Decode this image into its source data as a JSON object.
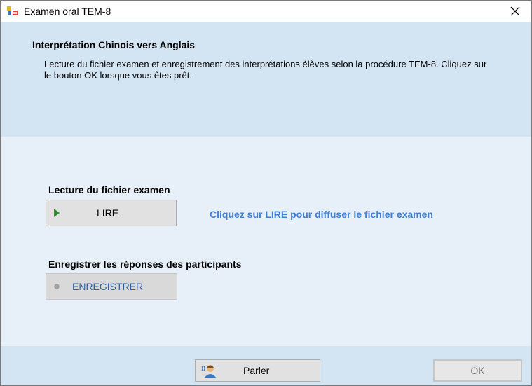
{
  "window": {
    "title": "Examen oral TEM-8",
    "close_glyph": "×"
  },
  "header": {
    "title": "Interprétation Chinois vers Anglais",
    "description": "Lecture du fichier examen et enregistrement des interprétations élèves selon la procédure TEM-8. Cliquez sur le bouton OK lorsque vous êtes prêt."
  },
  "sections": {
    "read": {
      "label": "Lecture du fichier examen",
      "button_label": "LIRE",
      "button_icon": "play-icon",
      "hint": "Cliquez sur LIRE pour diffuser le fichier examen"
    },
    "record": {
      "label": "Enregistrer les réponses des participants",
      "button_label": "ENREGISTRER",
      "button_icon": "record-dot-icon",
      "enabled": false
    }
  },
  "footer": {
    "speak_label": "Parler",
    "speak_icon": "speaker-person-icon",
    "ok_label": "OK"
  },
  "colors": {
    "header_bg": "#d3e4f3",
    "panel_bg": "#e7f0f8",
    "hint_text": "#3f7fd6",
    "play_icon": "#2e8b2e"
  }
}
